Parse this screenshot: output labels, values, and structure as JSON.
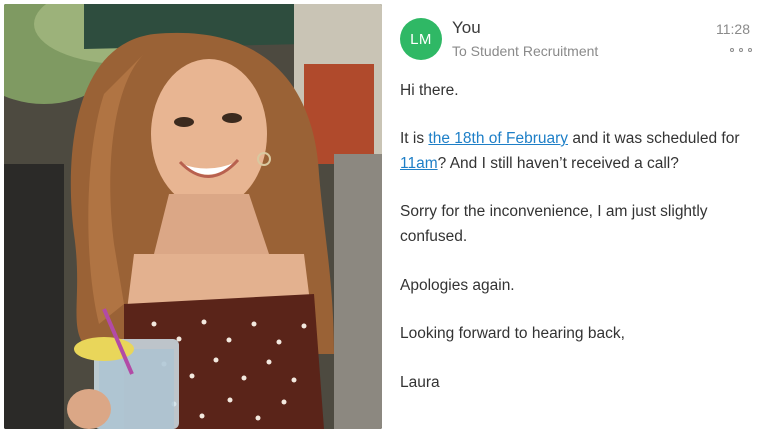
{
  "email": {
    "avatar_initials": "LM",
    "sender": "You",
    "recipient": "To Student Recruitment",
    "time": "11:28",
    "more_icon": "more-horizontal-icon",
    "greeting": "Hi there.",
    "para2": {
      "prefix": "It is ",
      "date_link": "the 18th of February",
      "mid": " and it was scheduled for ",
      "time_link": "11am",
      "suffix": "? And I still haven’t received a call?"
    },
    "para3": "Sorry for the inconvenience, I am just slightly confused.",
    "para4": "Apologies again.",
    "para5": "Looking forward to hearing back,",
    "signature": "Laura"
  },
  "colors": {
    "avatar_bg": "#2fb865",
    "link": "#1e7fc7",
    "meta_text": "#8a8a8a",
    "body_text": "#333333"
  }
}
